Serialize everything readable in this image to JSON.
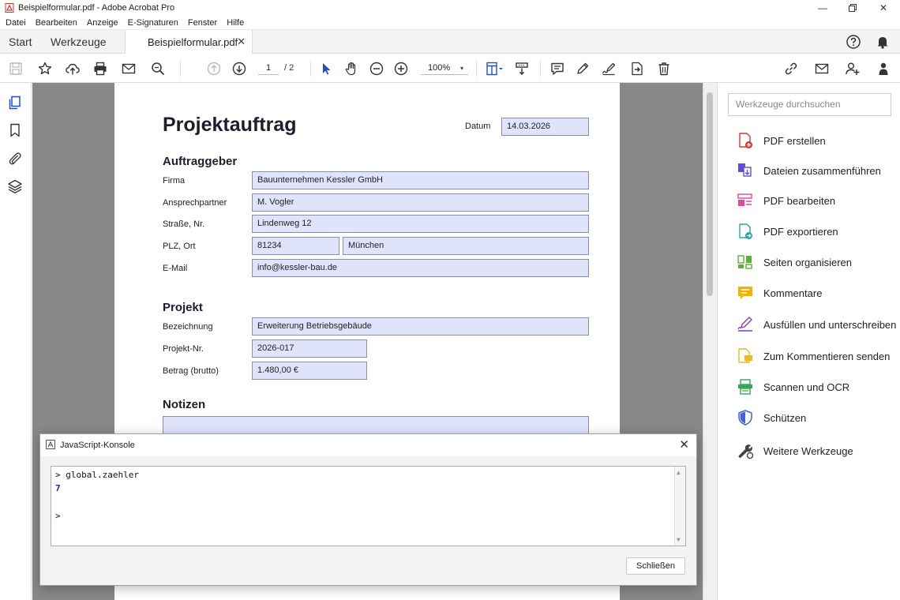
{
  "window": {
    "title": "Beispielformular.pdf - Adobe Acrobat Pro"
  },
  "menu": [
    "Datei",
    "Bearbeiten",
    "Anzeige",
    "E-Signaturen",
    "Fenster",
    "Hilfe"
  ],
  "tabs": {
    "start": "Start",
    "tools": "Werkzeuge",
    "document": "Beispielformular.pdf",
    "close_glyph": "✕"
  },
  "toolbar": {
    "current_page": "1",
    "page_total": "/ 2",
    "zoom": "100%"
  },
  "form": {
    "title": "Projektauftrag",
    "date_label": "Datum",
    "date_value": "14.03.2026",
    "section_client": "Auftraggeber",
    "firma_label": "Firma",
    "firma_value": "Bauunternehmen Kessler GmbH",
    "contact_label": "Ansprechpartner",
    "contact_value": "M. Vogler",
    "street_label": "Straße, Nr.",
    "street_value": "Lindenweg 12",
    "city_label": "PLZ, Ort",
    "zip_value": "81234",
    "city_value": "München",
    "email_label": "E-Mail",
    "email_value": "info@kessler-bau.de",
    "section_project": "Projekt",
    "name_label": "Bezeichnung",
    "name_value": "Erweiterung Betriebsgebäude",
    "number_label": "Projekt-Nr.",
    "number_value": "2026-017",
    "amount_label": "Betrag (brutto)",
    "amount_value": "1.480,00 €",
    "section_notes": "Notizen"
  },
  "tools_pane": {
    "search_placeholder": "Werkzeuge durchsuchen",
    "items": [
      {
        "label": "PDF erstellen",
        "icon": "create-pdf-icon",
        "color": "#d9372f"
      },
      {
        "label": "Dateien zusammenführen",
        "icon": "combine-files-icon",
        "color": "#5a4fd6"
      },
      {
        "label": "PDF bearbeiten",
        "icon": "edit-pdf-icon",
        "color": "#e0479e"
      },
      {
        "label": "PDF exportieren",
        "icon": "export-pdf-icon",
        "color": "#2aa8a0"
      },
      {
        "label": "Seiten organisieren",
        "icon": "organize-pages-icon",
        "color": "#5bb134"
      },
      {
        "label": "Kommentare",
        "icon": "comment-icon",
        "color": "#f0b400"
      },
      {
        "label": "Ausfüllen und unterschreiben",
        "icon": "fill-sign-icon",
        "color": "#7a3fbf"
      },
      {
        "label": "Zum Kommentieren senden",
        "icon": "send-comments-icon",
        "color": "#e8b92a"
      },
      {
        "label": "Scannen und OCR",
        "icon": "scan-ocr-icon",
        "color": "#34a853"
      },
      {
        "label": "Schützen",
        "icon": "protect-icon",
        "color": "#4a63d3"
      },
      {
        "label": "Weitere Werkzeuge",
        "icon": "more-tools-icon",
        "color": "#444444"
      }
    ]
  },
  "console": {
    "title": "JavaScript-Konsole",
    "input_line": "> global.zaehler",
    "result": "7",
    "prompt": ">",
    "close_button": "Schließen"
  }
}
